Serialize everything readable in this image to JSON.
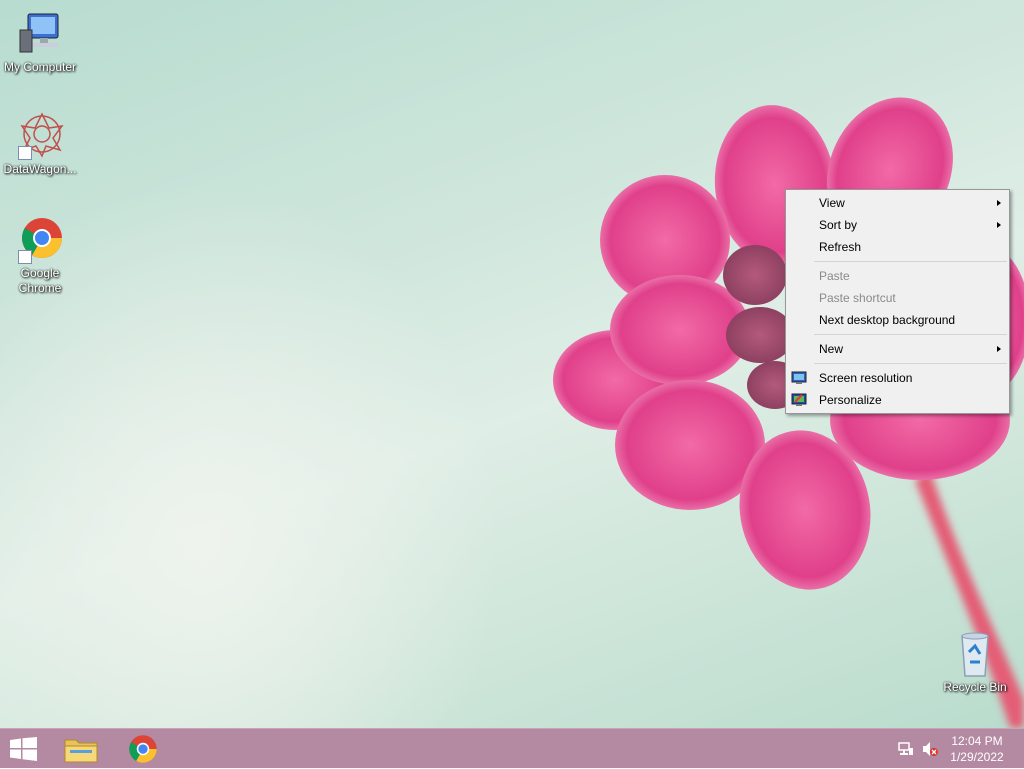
{
  "desktop": {
    "icons": [
      {
        "label": "My Computer",
        "icon": "computer-icon"
      },
      {
        "label": "DataWagon...",
        "icon": "datawagon-icon"
      },
      {
        "label": "Google Chrome",
        "icon": "chrome-icon"
      },
      {
        "label": "Recycle Bin",
        "icon": "recycle-bin-icon"
      }
    ]
  },
  "context_menu": {
    "view": "View",
    "sort_by": "Sort by",
    "refresh": "Refresh",
    "paste": "Paste",
    "paste_shortcut": "Paste shortcut",
    "next_background": "Next desktop background",
    "new": "New",
    "screen_resolution": "Screen resolution",
    "personalize": "Personalize"
  },
  "taskbar": {
    "start_icon": "windows-logo-icon",
    "pinned": [
      {
        "name": "File Explorer",
        "icon": "folder-icon"
      },
      {
        "name": "Google Chrome",
        "icon": "chrome-icon"
      }
    ],
    "tray": {
      "network_icon": "network-icon",
      "volume_icon": "volume-muted-icon"
    },
    "clock": {
      "time": "12:04 PM",
      "date": "1/29/2022"
    }
  },
  "colors": {
    "taskbar": "#b48aa3",
    "menu_bg": "#f0f0f0",
    "petal": "#e8438c"
  }
}
